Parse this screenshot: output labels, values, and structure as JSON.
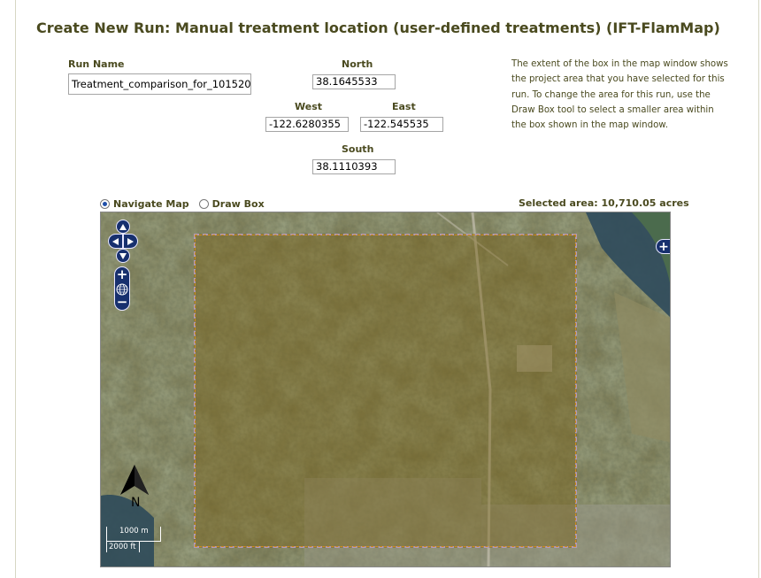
{
  "page": {
    "title": "Create New Run: Manual treatment location (user-defined treatments) (IFT-FlamMap)"
  },
  "form": {
    "run_name_label": "Run Name",
    "run_name_value": "Treatment_comparison_for_101520",
    "north_label": "North",
    "north_value": "38.1645533",
    "west_label": "West",
    "west_value": "-122.6280355",
    "east_label": "East",
    "east_value": "-122.545535",
    "south_label": "South",
    "south_value": "38.1110393"
  },
  "help_text": "The extent of the box in the map window shows the project area that you have selected for this run. To change the area for this run, use the Draw Box tool to select a smaller area within the box shown in the map window.",
  "map_controls": {
    "navigate_label": "Navigate Map",
    "draw_box_label": "Draw Box",
    "selected_mode": "navigate",
    "selected_area": "Selected area: 10,710.05 acres"
  },
  "map": {
    "north_arrow_label": "N",
    "scale_metric": "1000 m",
    "scale_imperial": "2000 ft",
    "pan_up_icon": "arrow-up-icon",
    "zoom_in_icon": "plus-icon",
    "zoom_out_icon": "minus-icon",
    "world_icon": "globe-icon",
    "layer_switcher_icon": "plus-icon"
  },
  "colors": {
    "text": "#4a4a1f",
    "control_blue": "#17306e",
    "selection_fill": "#785f14",
    "selection_border": "#b29ab9"
  }
}
